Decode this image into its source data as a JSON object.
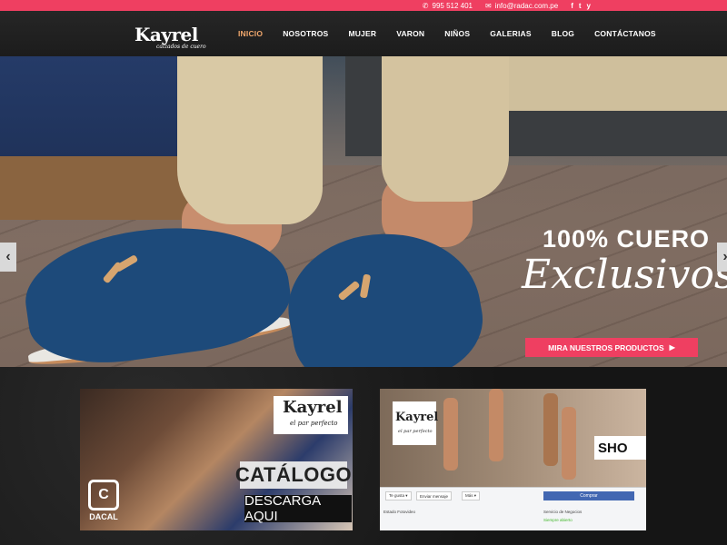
{
  "topbar": {
    "phone": "995 512 401",
    "email": "info@radac.com.pe",
    "socials": [
      "f",
      "t",
      "y"
    ]
  },
  "brand": {
    "name": "Kayrel",
    "tagline": "calzados de cuero"
  },
  "nav": {
    "items": [
      {
        "label": "INICIO",
        "active": true
      },
      {
        "label": "NOSOTROS"
      },
      {
        "label": "MUJER"
      },
      {
        "label": "VARON"
      },
      {
        "label": "NIÑOS"
      },
      {
        "label": "GALERIAS"
      },
      {
        "label": "BLOG"
      },
      {
        "label": "CONTÁCTANOS"
      }
    ]
  },
  "hero": {
    "headline": "100% CUERO",
    "script": "Exclusivos",
    "cta_label": "MIRA NUESTROS PRODUCTOS",
    "cta_arrow": "▶",
    "prev": "‹",
    "next": "›"
  },
  "catalog": {
    "brand": "Kayrel",
    "tagline": "el par perfecto",
    "title": "CATÁLOGO",
    "subtitle": "DESCARGA AQUI",
    "partner_mark": "C",
    "partner": "DACAL"
  },
  "shop": {
    "brand": "Kayrel",
    "tagline": "el par perfecto",
    "label": "SHO",
    "fb": {
      "like": "Te gusta ▾",
      "message": "Enviar mensaje",
      "more": "Más ▾",
      "buy": "Comprar",
      "status_left": "Estado    Fotovideo",
      "info": "Servicio de Negocios",
      "open": "Siempre abierto"
    }
  },
  "colors": {
    "accent": "#ef3f61",
    "nav_bg": "#1f1f1f",
    "active_nav": "#f0a76c"
  }
}
